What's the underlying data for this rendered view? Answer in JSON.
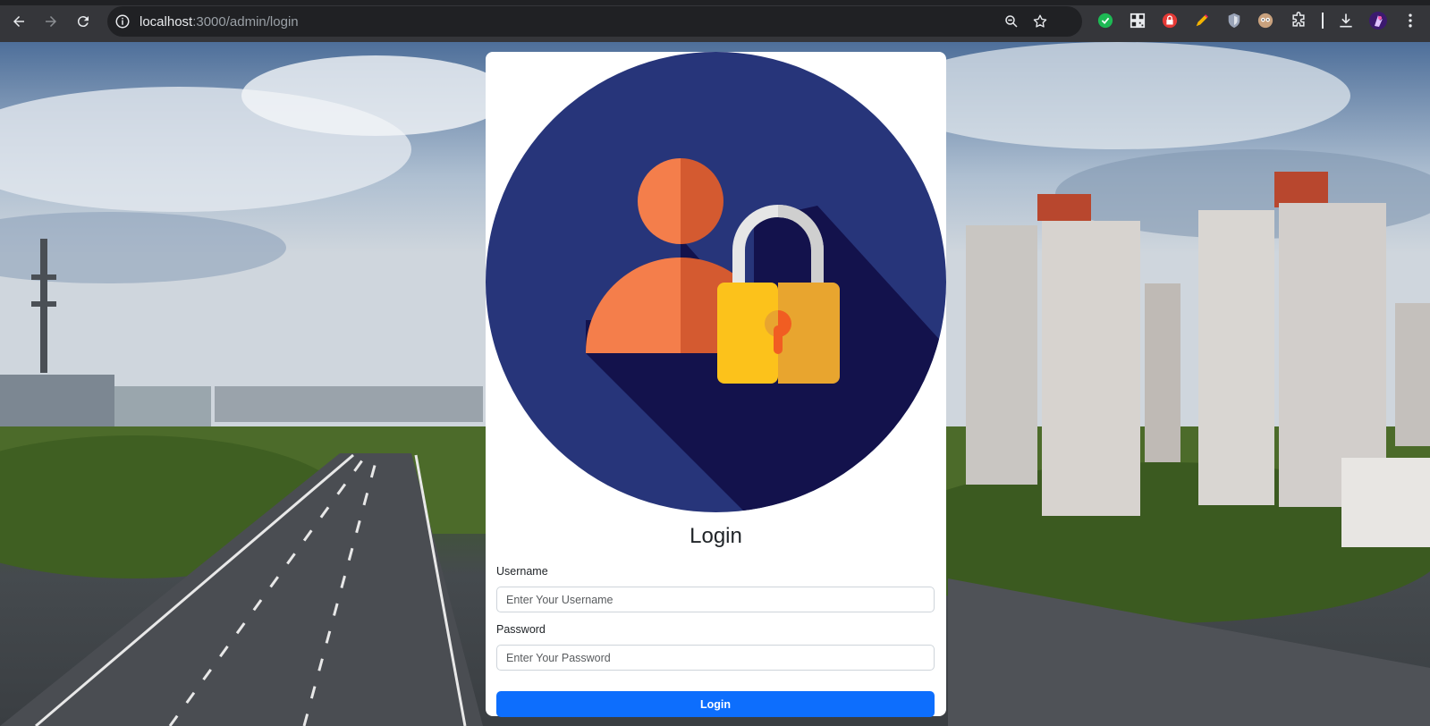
{
  "browser": {
    "url_host": "localhost",
    "url_path": ":3000/admin/login",
    "nav": {
      "back": "back-arrow-icon",
      "forward": "forward-arrow-icon",
      "reload": "reload-icon"
    },
    "omnibox_icons": [
      "site-info-icon",
      "zoom-icon",
      "bookmark-star-icon"
    ],
    "extensions": [
      "check-extension-icon",
      "qr-extension-icon",
      "lock-extension-icon",
      "pen-extension-icon",
      "shield-extension-icon",
      "face-extension-icon",
      "puzzle-icon"
    ],
    "toolbar": [
      "download-icon",
      "profile-avatar",
      "menu-kebab-icon"
    ]
  },
  "form": {
    "title": "Login",
    "username_label": "Username",
    "username_placeholder": "Enter Your Username",
    "password_label": "Password",
    "password_placeholder": "Enter Your Password",
    "submit_label": "Login"
  },
  "colors": {
    "primary": "#0d6efd",
    "hero_circle": "#27357a",
    "hero_shadow": "#13124c",
    "user_light": "#f47e4b",
    "user_dark": "#d45a30",
    "lock_light": "#fcc21b",
    "lock_dark": "#e8a52f"
  }
}
